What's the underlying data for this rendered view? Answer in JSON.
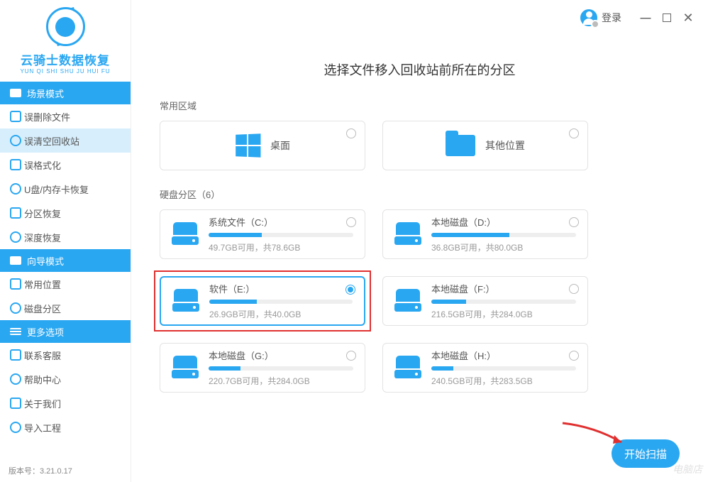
{
  "header": {
    "login": "登录"
  },
  "brand": {
    "name": "云骑士数据恢复",
    "sub": "YUN QI SHI SHU JU HUI FU"
  },
  "sidebar": {
    "section1": {
      "title": "场景模式",
      "items": [
        "误删除文件",
        "误清空回收站",
        "误格式化",
        "U盘/内存卡恢复",
        "分区恢复",
        "深度恢复"
      ],
      "activeIndex": 1
    },
    "section2": {
      "title": "向导模式",
      "items": [
        "常用位置",
        "磁盘分区"
      ]
    },
    "section3": {
      "title": "更多选项",
      "items": [
        "联系客服",
        "帮助中心",
        "关于我们",
        "导入工程"
      ]
    }
  },
  "version": "版本号：3.21.0.17",
  "main": {
    "title": "选择文件移入回收站前所在的分区",
    "commonLabel": "常用区域",
    "common": [
      {
        "label": "桌面",
        "icon": "windows"
      },
      {
        "label": "其他位置",
        "icon": "folder"
      }
    ],
    "partitionLabel": "硬盘分区（6）",
    "partitions": [
      {
        "name": "系统文件（C:）",
        "stat": "49.7GB可用，共78.6GB",
        "pct": 37
      },
      {
        "name": "本地磁盘（D:）",
        "stat": "36.8GB可用，共80.0GB",
        "pct": 54
      },
      {
        "name": "软件（E:）",
        "stat": "26.9GB可用，共40.0GB",
        "pct": 33,
        "selected": true
      },
      {
        "name": "本地磁盘（F:）",
        "stat": "216.5GB可用，共284.0GB",
        "pct": 24
      },
      {
        "name": "本地磁盘（G:）",
        "stat": "220.7GB可用，共284.0GB",
        "pct": 22
      },
      {
        "name": "本地磁盘（H:）",
        "stat": "240.5GB可用，共283.5GB",
        "pct": 15
      }
    ],
    "scanBtn": "开始扫描"
  },
  "watermark": "电脑店"
}
